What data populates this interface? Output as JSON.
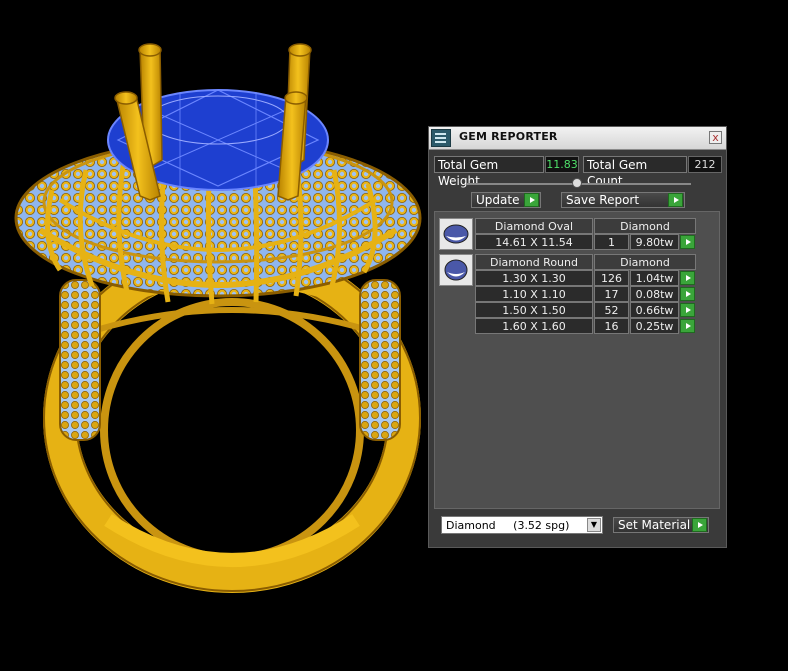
{
  "panel": {
    "title": "GEM REPORTER",
    "close_label": "x",
    "total_weight_label": "Total Gem Weight",
    "total_weight_value": "11.83",
    "total_count_label": "Total Gem Count",
    "total_count_value": "212",
    "slider_level": 0.5,
    "update_label": "Update",
    "save_report_label": "Save Report",
    "material_select": "Diamond     (3.52 spg)",
    "set_material_label": "Set Material"
  },
  "groups": [
    {
      "shape": "Diamond Oval",
      "material": "Diamond",
      "rows": [
        {
          "size": "14.61 X 11.54",
          "count": "1",
          "weight": "9.80tw"
        }
      ]
    },
    {
      "shape": "Diamond Round",
      "material": "Diamond",
      "rows": [
        {
          "size": "1.30 X 1.30",
          "count": "126",
          "weight": "1.04tw"
        },
        {
          "size": "1.10 X 1.10",
          "count": "17",
          "weight": "0.08tw"
        },
        {
          "size": "1.50 X 1.50",
          "count": "52",
          "weight": "0.66tw"
        },
        {
          "size": "1.60 X 1.60",
          "count": "16",
          "weight": "0.25tw"
        }
      ]
    }
  ],
  "colors": {
    "gold": "#e9b416",
    "gold_dark": "#8a5d00",
    "gem_blue": "#1e3fd0",
    "pave_blue": "#8fb6ee",
    "value_green": "#4fe06a",
    "button_green": "#3aa53a"
  },
  "icons": {
    "title": "gem-reporter-icon",
    "close": "close-icon",
    "play": "green-arrow-icon",
    "oval": "oval-gem-icon",
    "round": "round-gem-icon",
    "dropdown": "chevron-down-icon"
  }
}
